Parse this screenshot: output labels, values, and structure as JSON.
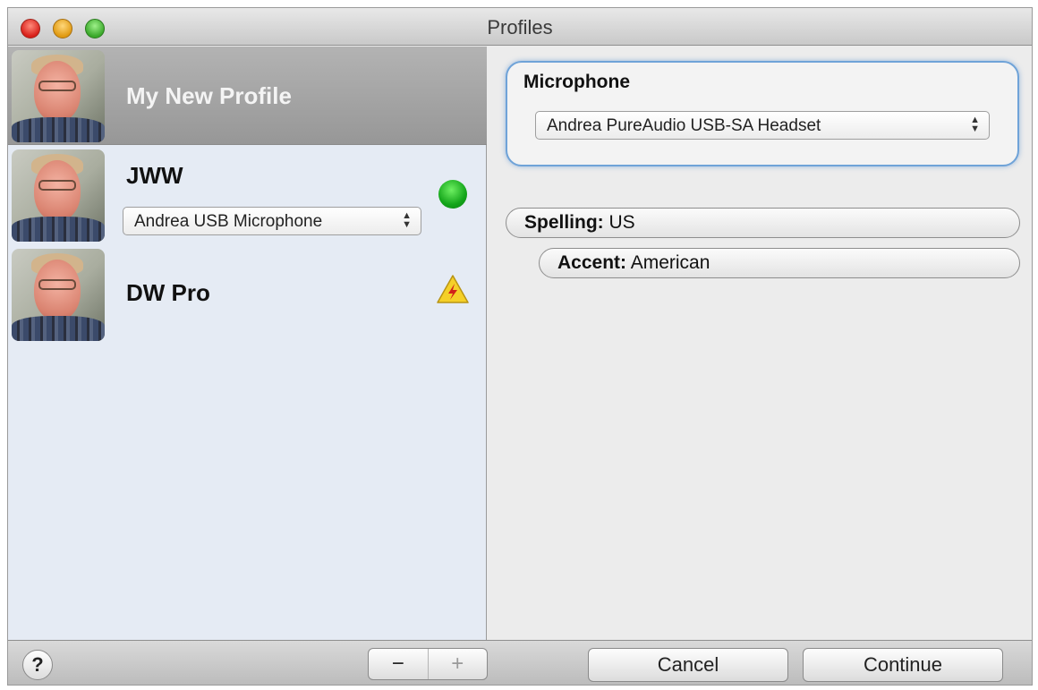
{
  "window": {
    "title": "Profiles"
  },
  "profiles": [
    {
      "name": "My New Profile",
      "selected": true
    },
    {
      "name": "JWW",
      "microphone": "Andrea USB Microphone",
      "status_icon": "green-status-dot-icon"
    },
    {
      "name": "DW Pro",
      "status_icon": "warning-triangle-icon"
    }
  ],
  "microphone": {
    "title": "Microphone",
    "selected": "Andrea PureAudio USB-SA Headset"
  },
  "spelling": {
    "key": "Spelling:",
    "value": "US"
  },
  "accent": {
    "key": "Accent:",
    "value": "American"
  },
  "bottom": {
    "help_label": "?",
    "remove_label": "−",
    "add_label": "+",
    "cancel_label": "Cancel",
    "continue_label": "Continue"
  },
  "colors": {
    "selection": "#9e9e9e",
    "status_green": "#1eb21e",
    "warning_yellow": "#f5d028",
    "focus_ring": "#6fa3d8"
  }
}
